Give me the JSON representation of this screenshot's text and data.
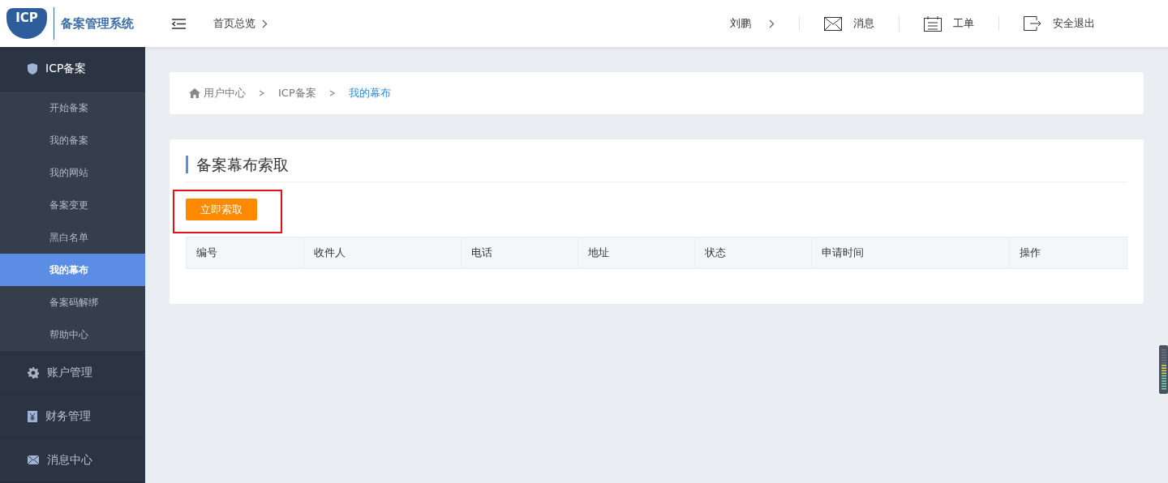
{
  "logo": {
    "mark": "ICP",
    "name": "备案管理系统"
  },
  "header": {
    "home": "首页总览",
    "user": "刘鹏",
    "actions": [
      {
        "kind": "mail",
        "label": "消息"
      },
      {
        "kind": "ticket",
        "label": "工单"
      },
      {
        "kind": "logout",
        "label": "安全退出"
      }
    ]
  },
  "sidebar": {
    "groups": [
      {
        "kind": "shield",
        "label": "ICP备案",
        "expanded": true,
        "items": [
          {
            "label": "开始备案",
            "selected": false
          },
          {
            "label": "我的备案",
            "selected": false
          },
          {
            "label": "我的网站",
            "selected": false
          },
          {
            "label": "备案变更",
            "selected": false
          },
          {
            "label": "黑白名单",
            "selected": false
          },
          {
            "label": "我的幕布",
            "selected": true
          },
          {
            "label": "备案码解绑",
            "selected": false
          },
          {
            "label": "帮助中心",
            "selected": false
          }
        ]
      },
      {
        "kind": "gear",
        "label": "账户管理",
        "expanded": false
      },
      {
        "kind": "yen",
        "label": "财务管理",
        "expanded": false
      },
      {
        "kind": "mail",
        "label": "消息中心",
        "expanded": false
      }
    ]
  },
  "breadcrumb": [
    "用户中心",
    "ICP备案",
    "我的幕布"
  ],
  "panel": {
    "title": "备案幕布索取",
    "button": "立即索取",
    "table": {
      "columns": [
        "编号",
        "收件人",
        "电话",
        "地址",
        "状态",
        "申请时间",
        "操作"
      ]
    }
  }
}
